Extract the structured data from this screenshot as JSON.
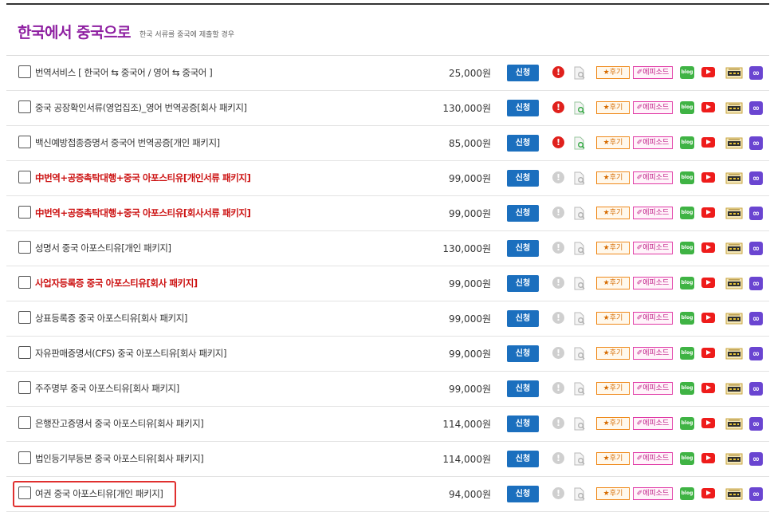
{
  "header": {
    "title": "한국에서 중국으로",
    "subtitle": "한국 서류를 중국에 제출할 경우"
  },
  "buttons": {
    "apply_label": "신청",
    "review_label": "★후기",
    "episode_label": "✐에피소드",
    "blog_label": "blog",
    "warn_label": "!",
    "link_label": "∞"
  },
  "colors": {
    "title": "#8e1fa1",
    "apply": "#1b6fbe",
    "highlight_name": "#cc1111",
    "warn_active": "#e0201c",
    "selection_outline": "#e0302f"
  },
  "rows": [
    {
      "name": "번역서비스 [ 한국어 ⇆ 중국어 / 영어 ⇆ 중국어 ]",
      "price": "25,000원",
      "red": false,
      "warn": true,
      "doc_active": false,
      "selected": false
    },
    {
      "name": "중국 공장확인서류(영업집조)_영어 번역공증[회사 패키지]",
      "price": "130,000원",
      "red": false,
      "warn": true,
      "doc_active": true,
      "selected": false
    },
    {
      "name": "백신예방접종증명서 중국어 번역공증[개인 패키지]",
      "price": "85,000원",
      "red": false,
      "warn": true,
      "doc_active": true,
      "selected": false
    },
    {
      "name": "中번역+공증촉탁대행+중국 아포스티유[개인서류 패키지]",
      "price": "99,000원",
      "red": true,
      "warn": false,
      "doc_active": false,
      "selected": false
    },
    {
      "name": "中번역+공증촉탁대행+중국 아포스티유[회사서류 패키지]",
      "price": "99,000원",
      "red": true,
      "warn": false,
      "doc_active": false,
      "selected": false
    },
    {
      "name": "성명서 중국 아포스티유[개인 패키지]",
      "price": "130,000원",
      "red": false,
      "warn": false,
      "doc_active": false,
      "selected": false
    },
    {
      "name": "사업자등록증 중국 아포스티유[회사 패키지]",
      "price": "99,000원",
      "red": true,
      "warn": false,
      "doc_active": false,
      "selected": false
    },
    {
      "name": "상표등록증 중국 아포스티유[회사 패키지]",
      "price": "99,000원",
      "red": false,
      "warn": false,
      "doc_active": false,
      "selected": false
    },
    {
      "name": "자유판매증명서(CFS) 중국 아포스티유[회사 패키지]",
      "price": "99,000원",
      "red": false,
      "warn": false,
      "doc_active": false,
      "selected": false
    },
    {
      "name": "주주명부 중국 아포스티유[회사 패키지]",
      "price": "99,000원",
      "red": false,
      "warn": false,
      "doc_active": false,
      "selected": false
    },
    {
      "name": "은행잔고증명서 중국 아포스티유[회사 패키지]",
      "price": "114,000원",
      "red": false,
      "warn": false,
      "doc_active": false,
      "selected": false
    },
    {
      "name": "법인등기부등본 중국 아포스티유[회사 패키지]",
      "price": "114,000원",
      "red": false,
      "warn": false,
      "doc_active": false,
      "selected": false
    },
    {
      "name": "여권 중국 아포스티유[개인 패키지]",
      "price": "94,000원",
      "red": false,
      "warn": false,
      "doc_active": false,
      "selected": true
    }
  ]
}
